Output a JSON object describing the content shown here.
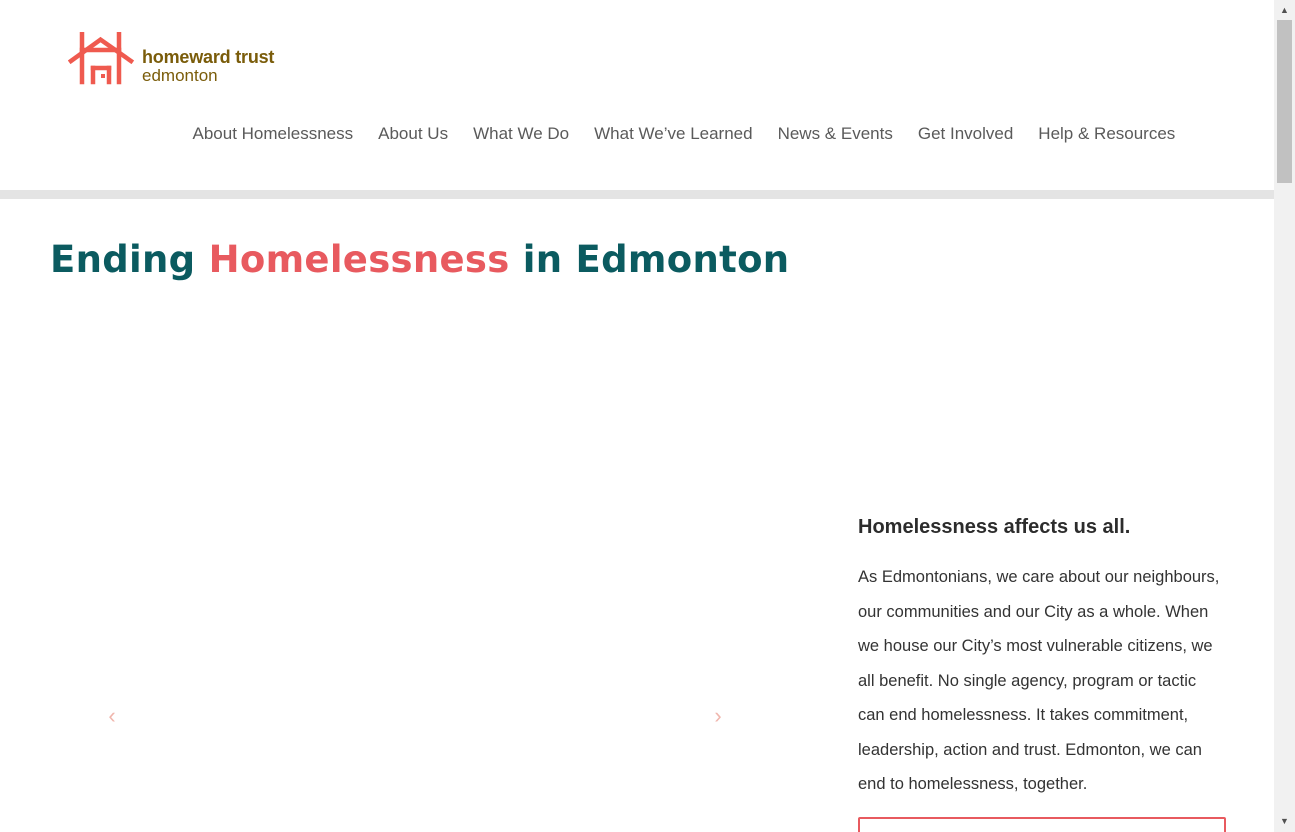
{
  "logo": {
    "line1": "homeward trust",
    "line2": "edmonton",
    "icon": "house-h-icon",
    "colors": {
      "mark": "#ef5a4f",
      "text": "#7a5c0a"
    }
  },
  "nav": {
    "items": [
      {
        "label": "About Homelessness"
      },
      {
        "label": "About Us"
      },
      {
        "label": "What We Do"
      },
      {
        "label": "What We’ve Learned"
      },
      {
        "label": "News & Events"
      },
      {
        "label": "Get Involved"
      },
      {
        "label": "Help & Resources"
      }
    ]
  },
  "hero": {
    "title_part1": "Ending ",
    "title_accent": "Homelessness",
    "title_part2": " in Edmonton",
    "colors": {
      "primary": "#0b5b60",
      "accent": "#e85a5f"
    }
  },
  "slider": {
    "prev_icon": "chevron-left-icon",
    "prev_glyph": "‹",
    "next_icon": "chevron-right-icon",
    "next_glyph": "›"
  },
  "intro": {
    "heading": "Homelessness affects us all.",
    "body": "As Edmontonians, we care about our neighbours, our communities and our City as a whole. When we house our City’s most vulnerable citizens, we all benefit. No single agency, program or tactic can end homelessness. It takes commitment, leadership, action and trust. Edmonton, we can end to homelessness, together."
  },
  "scrollbar": {
    "up_glyph": "▲",
    "down_glyph": "▼"
  }
}
